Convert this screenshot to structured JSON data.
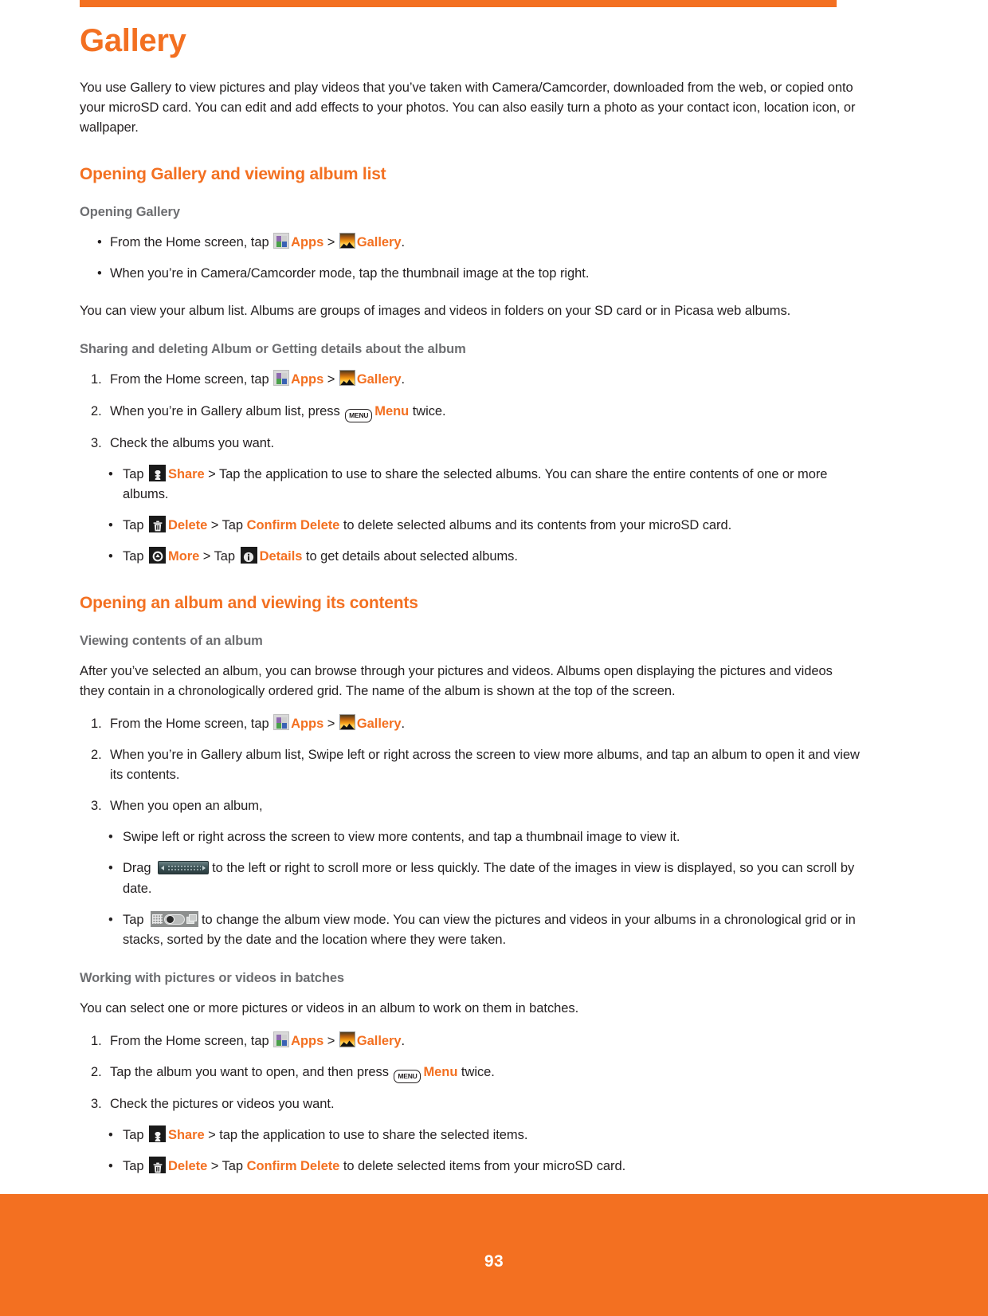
{
  "document": {
    "chapter_title": "Gallery",
    "page_number": "93",
    "accent_color": "#f37021",
    "heading_gray": "#6d6e71",
    "body_color": "#231f20"
  },
  "intro": {
    "paragraph": "You use Gallery to view pictures and play videos that you’ve taken with Camera/Camcorder, downloaded from the web, or copied onto your microSD card. You can edit and add effects to your photos. You can also easily turn a photo as your contact icon, location icon, or wallpaper."
  },
  "section1": {
    "title": "Opening Gallery and viewing album list",
    "sub1": {
      "title": "Opening Gallery",
      "bullet1": {
        "pre": "From the Home screen, tap",
        "apps_label": "Apps",
        "separator": ">",
        "gallery_label": "Gallery",
        "post": "."
      },
      "bullet2": "When you’re in Camera/Camcorder mode, tap the thumbnail image at the top right."
    },
    "paragraph": "You can view your album list. Albums are groups of images and videos in folders on your SD card or in Picasa web albums.",
    "sub2": {
      "title": "Sharing and deleting Album or Getting details  about the album",
      "step1": {
        "num": "1.",
        "pre": "From the Home screen, tap",
        "apps_label": "Apps",
        "separator": ">",
        "gallery_label": "Gallery",
        "post": "."
      },
      "step2": {
        "num": "2.",
        "pre": "When you’re in Gallery album list, press",
        "menu_key_label": "MENU",
        "menu_label": "Menu",
        "post": "twice."
      },
      "step3": {
        "num": "3.",
        "text": "Check the albums you want."
      },
      "bullets": [
        {
          "pre": "Tap",
          "action_label": "Share",
          "mid": "> Tap the application to use to share the selected albums. You can share the entire contents of one or more albums."
        },
        {
          "pre": "Tap",
          "action_label": "Delete",
          "mid": "> Tap",
          "confirm_label": "Confirm Delete",
          "post": "to delete selected albums and its contents from your microSD card."
        },
        {
          "pre": "Tap",
          "action_label": "More",
          "mid": "> Tap",
          "details_label": "Details",
          "post": "to get details about selected albums."
        }
      ]
    }
  },
  "section2": {
    "title": "Opening an album and viewing its contents",
    "sub1": {
      "title": "Viewing contents of an album",
      "paragraph": "After you’ve selected an album, you can browse through your pictures and videos. Albums open displaying the pictures and videos they contain in a chronologically ordered grid. The name of the album is shown at the top of the screen.",
      "step1": {
        "num": "1.",
        "pre": "From the Home screen, tap",
        "apps_label": "Apps",
        "separator": ">",
        "gallery_label": "Gallery",
        "post": "."
      },
      "step2": {
        "num": "2.",
        "text": "When you’re in Gallery album list, Swipe left or right across the screen to view more albums, and tap an album to open it and view its contents."
      },
      "step3": {
        "num": "3.",
        "text": "When you open an album,"
      },
      "bullets": [
        {
          "text": "Swipe left or right across the screen to view more contents, and tap a thumbnail image to view it."
        },
        {
          "pre": "Drag",
          "post": "to the left or right to scroll more or less quickly. The date of the images in view is displayed, so you can scroll by date."
        },
        {
          "pre": "Tap",
          "post": "to change the album view mode. You can view the pictures and videos in your albums in a chronological grid or in stacks, sorted by the date and the location where they were taken."
        }
      ]
    },
    "sub2": {
      "title": "Working with pictures or videos in batches",
      "paragraph": "You can select one or more pictures or videos in an album to work on them in batches.",
      "step1": {
        "num": "1.",
        "pre": "From the Home screen, tap",
        "apps_label": "Apps",
        "separator": ">",
        "gallery_label": "Gallery",
        "post": "."
      },
      "step2": {
        "num": "2.",
        "pre": "Tap the album you want to open, and then press",
        "menu_key_label": "MENU",
        "menu_label": "Menu",
        "post": "twice."
      },
      "step3": {
        "num": "3.",
        "text": "Check the pictures or videos you want."
      },
      "bullets": [
        {
          "pre": "Tap",
          "action_label": "Share",
          "mid": "> tap the application to use to share the selected items."
        },
        {
          "pre": "Tap",
          "action_label": "Delete",
          "mid": "> Tap",
          "confirm_label": "Confirm Delete",
          "post": "to delete selected items from your microSD card."
        }
      ]
    }
  },
  "icons": {
    "apps": "apps-grid-icon",
    "gallery": "gallery-photo-icon",
    "menu_key": "menu-hardware-key-icon",
    "share": "share-icon",
    "delete": "trash-icon",
    "more": "more-icon",
    "details": "info-icon",
    "drag_handle": "drag-scrub-handle-icon",
    "view_mode": "view-mode-toggle-icon"
  },
  "bullet_char": "•"
}
